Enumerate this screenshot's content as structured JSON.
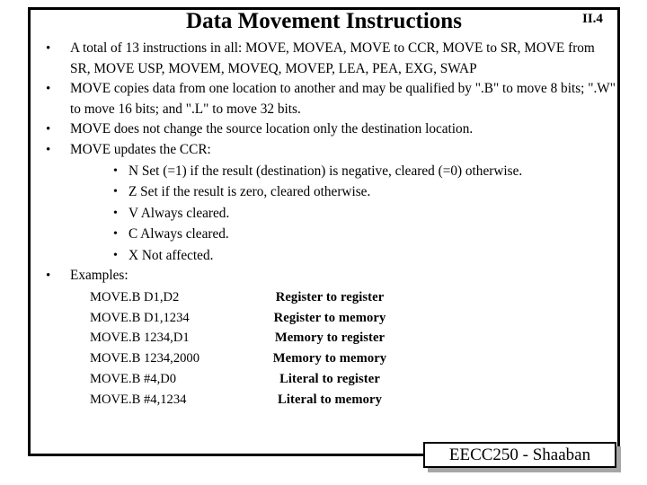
{
  "slide": {
    "title": "Data Movement Instructions",
    "number": "II.4",
    "bullet_marker": "•",
    "sub_marker": "•"
  },
  "bullets": [
    {
      "text": "A total of 13 instructions  in all:  MOVE, MOVEA, MOVE to CCR, MOVE to SR, MOVE from SR, MOVE USP, MOVEM,  MOVEQ, MOVEP, LEA, PEA, EXG, SWAP"
    },
    {
      "text": " MOVE copies data from one location to another and may be qualified by \".B\" to move 8 bits; \".W\" to move 16 bits;  and \".L\" to move 32 bits."
    },
    {
      "text": "MOVE does not change the source location only the destination location."
    },
    {
      "text": "MOVE updates the CCR:"
    }
  ],
  "ccr_flags": [
    {
      "text": "N  Set  (=1) if the result  (destination) is negative, cleared  (=0) otherwise."
    },
    {
      "text": "Z Set if the result is zero, cleared otherwise."
    },
    {
      "text": "V Always  cleared."
    },
    {
      "text": "C Always cleared."
    },
    {
      "text": "X Not affected."
    }
  ],
  "examples": {
    "heading": "Examples:",
    "rows": [
      {
        "instruction": "MOVE.B D1,D2",
        "description": "Register to register"
      },
      {
        "instruction": "MOVE.B D1,1234",
        "description": "Register to memory"
      },
      {
        "instruction": "MOVE.B 1234,D1",
        "description": "Memory to register"
      },
      {
        "instruction": "MOVE.B 1234,2000",
        "description": "Memory to memory"
      },
      {
        "instruction": "MOVE.B #4,D0",
        "description": "Literal to register"
      },
      {
        "instruction": "MOVE.B #4,1234",
        "description": "Literal to memory"
      }
    ]
  },
  "footer": {
    "label": "EECC250 - Shaaban"
  },
  "colors": {
    "background": "#ffffff",
    "text": "#000000",
    "frame": "#000000",
    "badge_shadow": "#a6a6a6"
  }
}
